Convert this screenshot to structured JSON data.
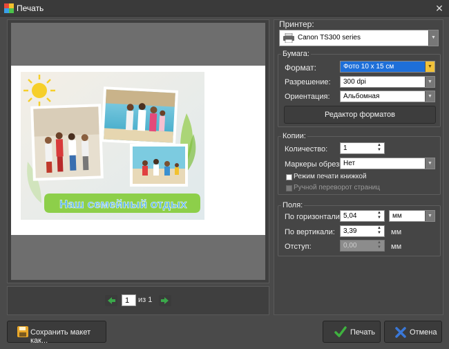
{
  "window": {
    "title": "Печать",
    "close_glyph": "✕"
  },
  "preview": {
    "photo_caption": "Наш семейный отдых",
    "pager": {
      "current_page": "1",
      "of_label": "из 1"
    }
  },
  "printer": {
    "label": "Принтер:",
    "selected": "Canon TS300 series"
  },
  "paper": {
    "group_title": "Бумага:",
    "format_label": "Формат:",
    "format_value": "Фото 10 x 15 см",
    "resolution_label": "Разрешение:",
    "resolution_value": "300 dpi",
    "orientation_label": "Ориентация:",
    "orientation_value": "Альбомная",
    "editor_button": "Редактор форматов"
  },
  "copies": {
    "group_title": "Копии:",
    "count_label": "Количество:",
    "count_value": "1",
    "crop_marks_label": "Маркеры обрезки:",
    "crop_marks_value": "Нет",
    "booklet_label": "Режим печати книжкой",
    "manual_flip_label": "Ручной переворот страниц"
  },
  "margins": {
    "group_title": "Поля:",
    "horizontal_label": "По горизонтали:",
    "horizontal_value": "5,04",
    "unit_value": "мм",
    "vertical_label": "По вертикали:",
    "vertical_value": "3,39",
    "vertical_unit": "мм",
    "indent_label": "Отступ:",
    "indent_value": "0,00",
    "indent_unit": "мм"
  },
  "actions": {
    "save_layout": "Сохранить макет как...",
    "print": "Печать",
    "cancel": "Отмена"
  },
  "colors": {
    "format_highlight": "#1e6fd8",
    "format_drop": "#f1c23a",
    "print_check": "#3fb23f",
    "cancel_x": "#3a78d8",
    "nav_arrow": "#3aa84a"
  }
}
